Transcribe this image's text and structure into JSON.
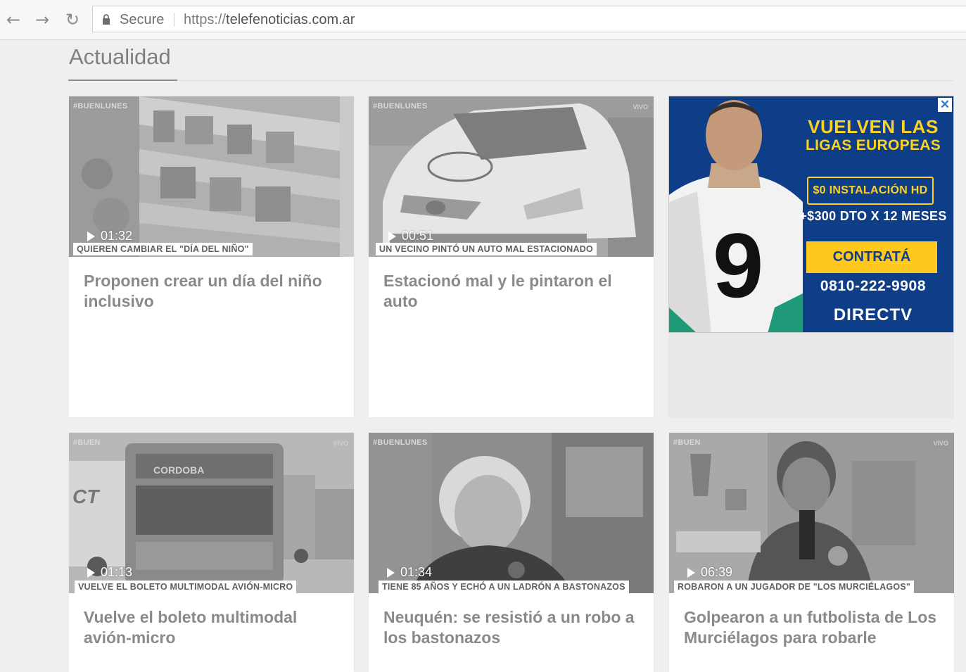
{
  "browser": {
    "back_icon": "arrow-left-icon",
    "forward_icon": "arrow-right-icon",
    "reload_icon": "reload-icon",
    "secure_label": "Secure",
    "url_scheme": "https://",
    "url_host": "telefenoticias.com.ar"
  },
  "section": {
    "title": "Actualidad"
  },
  "cards": [
    {
      "tag": "#BUENLUNES",
      "duration": "01:32",
      "caption": "QUIEREN CAMBIAR EL \"DÍA DEL NIÑO\"",
      "title": "Proponen crear un día del niño inclusivo"
    },
    {
      "tag": "#BUENLUNES",
      "badge": "VIVO",
      "duration": "00:51",
      "caption": "UN VECINO PINTÓ UN AUTO MAL ESTACIONADO",
      "title": "Estacionó mal y le pintaron el auto"
    },
    {
      "tag": "#BUEN",
      "badge": "VIVO",
      "duration": "01:13",
      "caption": "VUELVE EL BOLETO MULTIMODAL AVIÓN-MICRO",
      "title": "Vuelve el boleto multimodal avión-micro"
    },
    {
      "tag": "#BUENLUNES",
      "duration": "01:34",
      "caption": "TIENE 85 AÑOS Y ECHÓ A UN LADRÓN A BASTONAZOS",
      "title": "Neuquén: se resistió a un robo a los bastonazos"
    },
    {
      "tag": "#BUEN",
      "badge": "VIVO",
      "duration": "06:39",
      "caption": "ROBARON A UN JUGADOR DE \"LOS MURCIÉLAGOS\"",
      "title": "Golpearon a un futbolista de Los Murciélagos para robarle"
    }
  ],
  "ad": {
    "close_label": "✕",
    "headline_1": "VUELVEN LAS",
    "headline_2": "LIGAS EUROPEAS",
    "box_text": "$0 INSTALACIÓN HD",
    "promo": "+$300 DTO X 12 MESES",
    "cta": "CONTRATÁ",
    "phone": "0810-222-9908",
    "brand": "DIRECTV",
    "jersey_number": "9",
    "colors": {
      "background": "#0f3e89",
      "accent": "#ffd21f"
    }
  }
}
